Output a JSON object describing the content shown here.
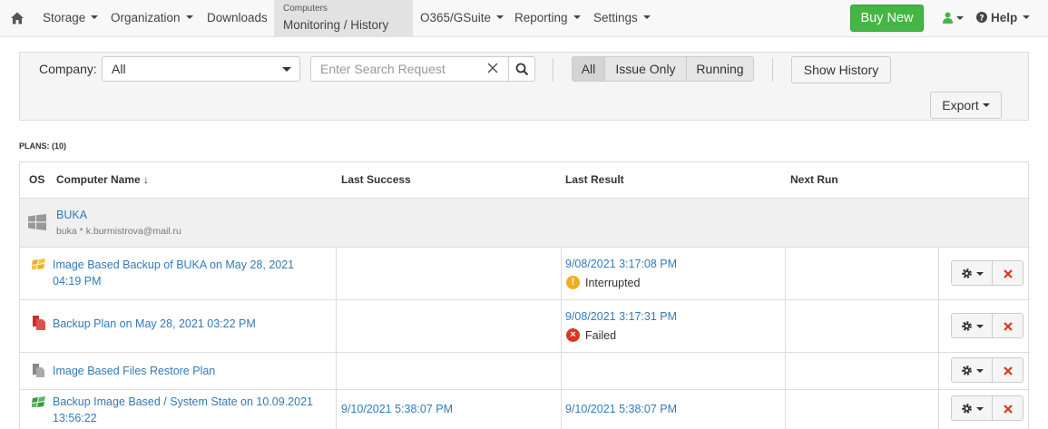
{
  "nav": {
    "items": [
      "Storage",
      "Organization",
      "Downloads"
    ],
    "active_sub": "Computers",
    "active_main": "Monitoring / History",
    "items_right": [
      "O365/GSuite",
      "Reporting",
      "Settings"
    ],
    "buy_label": "Buy New",
    "help_label": "Help",
    "brand_green": "#45b645"
  },
  "filters": {
    "company_label": "Company:",
    "company_value": "All",
    "search_placeholder": "Enter Search Request",
    "toggle": [
      "All",
      "Issue Only",
      "Running"
    ],
    "show_history": "Show History",
    "export": "Export"
  },
  "plans_label": "PLANS: (10)",
  "table": {
    "headers": [
      "OS",
      "Computer Name ↓",
      "Last Success",
      "Last Result",
      "Next Run"
    ],
    "group": {
      "name": "BUKA",
      "sub": "buka * k.burmistrova@mail.ru"
    },
    "rows": [
      {
        "name": "Image Based Backup of BUKA on May 28, 2021 04:19 PM",
        "icon": "image-backup-icon",
        "last_success": "",
        "last_result": "9/08/2021 3:17:08 PM",
        "status": "Interrupted",
        "status_color": "#f0ad1f"
      },
      {
        "name": "Backup Plan on May 28, 2021 03:22 PM",
        "icon": "file-backup-icon",
        "last_success": "",
        "last_result": "9/08/2021 3:17:31 PM",
        "status": "Failed",
        "status_color": "#d9381e"
      },
      {
        "name": "Image Based Files Restore Plan",
        "icon": "restore-icon",
        "last_success": "",
        "last_result": "",
        "status": "",
        "status_color": ""
      },
      {
        "name": "Backup Image Based / System State on 10.09.2021 13:56:22",
        "icon": "system-state-icon",
        "last_success": "9/10/2021 5:38:07 PM",
        "last_result": "9/10/2021 5:38:07 PM",
        "status": "",
        "status_color": ""
      }
    ]
  }
}
